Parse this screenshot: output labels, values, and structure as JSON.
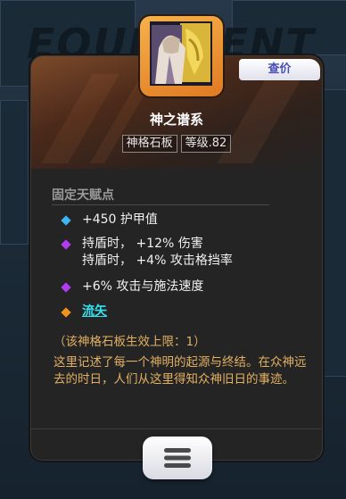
{
  "background": {
    "watermark_text": "EQUIPMENT"
  },
  "item": {
    "name": "神之谱系",
    "type_tag": "神格石板",
    "level_tag": "等级.82",
    "check_button": "查价",
    "icon": "character-portrait-icon"
  },
  "fixed_talents": {
    "heading": "固定天赋点",
    "rows": [
      {
        "bullet_color": "#3fb4f2",
        "lines": [
          "+450 护甲值"
        ]
      },
      {
        "bullet_color": "#b13cf0",
        "lines": [
          "持盾时， +12% 伤害",
          "持盾时， +4% 攻击格挡率"
        ]
      },
      {
        "bullet_color": "#b13cf0",
        "lines": [
          "+6% 攻击与施法速度"
        ]
      },
      {
        "bullet_color": "#f0921c",
        "lines": [
          "流矢"
        ]
      }
    ]
  },
  "description": {
    "limit": "（该神格石板生效上限：1）",
    "lore": "这里记述了每一个神明的起源与终结。在众神远去的时日，人们从这里得知众神旧日的事迹。"
  },
  "menu_button": {
    "icon": "menu-icon"
  },
  "colors": {
    "lore_text": "#e3b062",
    "link": "#35e1ee",
    "icon_frame": "#f6b24a"
  }
}
